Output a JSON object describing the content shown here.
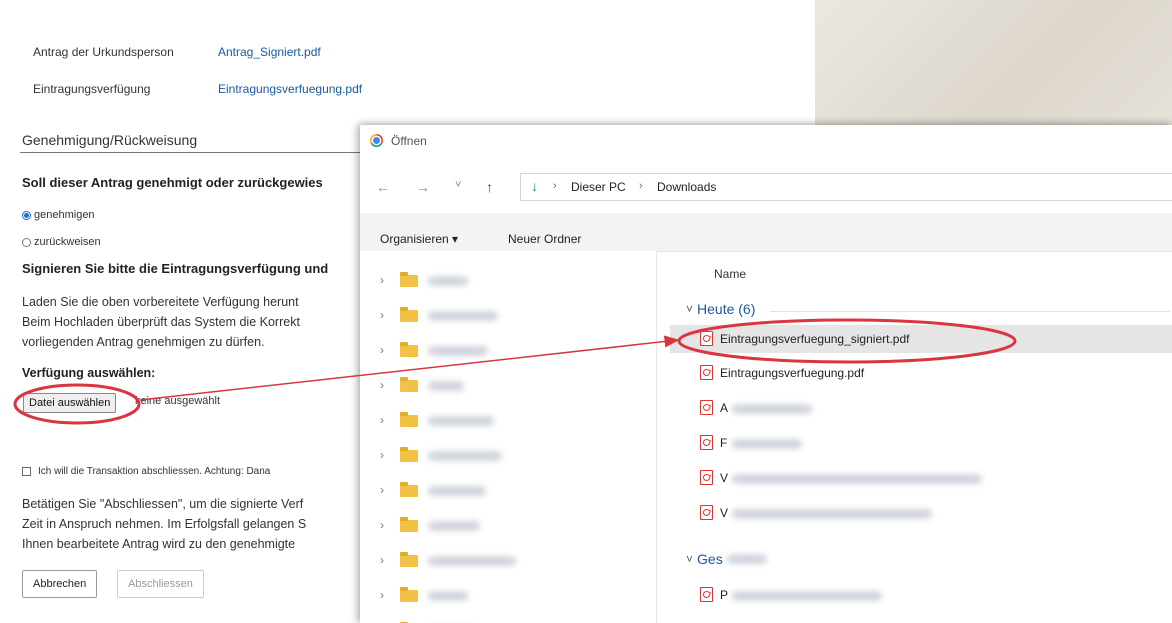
{
  "form": {
    "rows": [
      {
        "label": "Antrag der Urkundsperson",
        "link": "Antrag_Signiert.pdf"
      },
      {
        "label": "Eintragungsverfügung",
        "link": "Eintragungsverfuegung.pdf"
      }
    ],
    "section_title": "Genehmigung/Rückweisung",
    "question": "Soll dieser Antrag genehmigt oder zurückgewies",
    "radio_approve": "genehmigen",
    "radio_reject": "zurückweisen",
    "sign_heading": "Signieren Sie bitte die Eintragungsverfügung und",
    "para1": [
      "Laden Sie die oben vorbereitete Verfügung herunt",
      "Beim Hochladen überprüft das System die Korrekt",
      "vorliegenden Antrag genehmigen zu dürfen."
    ],
    "select_label": "Verfügung auswählen:",
    "file_button": "Datei auswählen",
    "file_none": "keine ausgewählt",
    "checkbox_label": "Ich will die Transaktion abschliessen. Achtung: Dana",
    "para2": [
      "Betätigen Sie \"Abschliessen\", um die signierte Verf",
      "Zeit in Anspruch nehmen. Im Erfolgsfall gelangen S",
      "Ihnen bearbeitete Antrag wird zu den genehmigte"
    ],
    "cancel_button": "Abbrechen",
    "finish_button": "Abschliessen"
  },
  "dialog": {
    "title": "Öffnen",
    "nav_back": "←",
    "nav_forward": "→",
    "nav_recent": "˅",
    "nav_up": "↑",
    "breadcrumb": [
      "Dieser PC",
      "Downloads"
    ],
    "toolbar_organize": "Organisieren ▾",
    "toolbar_new_folder": "Neuer Ordner",
    "column_name": "Name",
    "group_today": "Heute (6)",
    "group_yesterday": "Ges",
    "files_today": [
      {
        "name": "Eintragungsverfuegung_signiert.pdf",
        "selected": true
      },
      {
        "name": "Eintragungsverfuegung.pdf",
        "selected": false
      },
      {
        "name": "A",
        "selected": false
      },
      {
        "name": "F",
        "selected": false
      },
      {
        "name": "V",
        "selected": false
      },
      {
        "name": "V",
        "selected": false
      }
    ],
    "files_yesterday": [
      {
        "name": "P"
      }
    ]
  },
  "colors": {
    "link": "#1a5a9a",
    "annotation": "#d9363e",
    "pdf": "#dd3333",
    "folder": "#f3c244"
  }
}
